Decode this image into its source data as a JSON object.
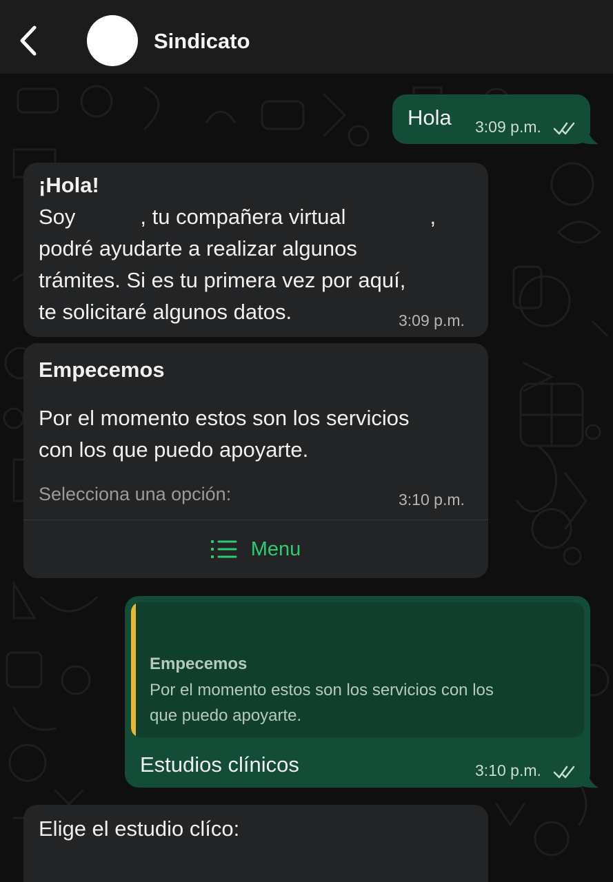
{
  "header": {
    "contact_name": "Sindicato"
  },
  "messages": {
    "m1": {
      "text": "Hola",
      "time": "3:09 p.m."
    },
    "m2": {
      "heading": "¡Hola!",
      "line1_a": "Soy",
      "line1_b": ", tu compañera virtual",
      "line1_c": ",",
      "line2": "podré ayudarte a realizar algunos",
      "line3": "trámites. Si es tu primera vez por aquí,",
      "line4": "te solicitaré algunos datos.",
      "time": "3:09 p.m."
    },
    "m3": {
      "title": "Empecemos",
      "body1": "Por el momento estos son los servicios",
      "body2": "con los que puedo apoyarte.",
      "footer": "Selecciona una opción:",
      "time": "3:10 p.m.",
      "menu_label": "Menu"
    },
    "m4": {
      "quote_title": "Empecemos",
      "quote_line1": "Por el momento estos son los servicios con los",
      "quote_line2": "que puedo apoyarte.",
      "text": "Estudios clínicos",
      "time": "3:10 p.m."
    },
    "m5": {
      "text": "Elige el estudio clíco:"
    }
  },
  "colors": {
    "incoming_bubble": "#232425",
    "outgoing_bubble": "#134d37",
    "quote_bar": "#e9b72f",
    "menu_accent": "#2ecc71"
  }
}
